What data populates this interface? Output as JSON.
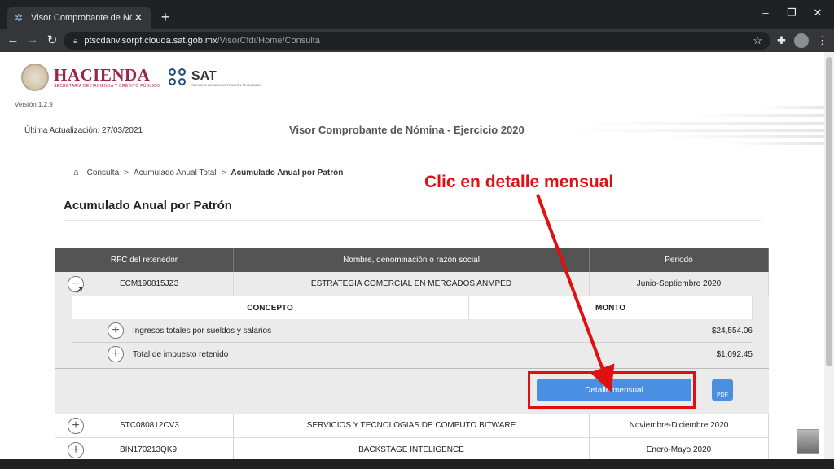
{
  "browser": {
    "tab_title": "Visor Comprobante de Nómina",
    "url_host": "ptscdanvisorpf.clouda.sat.gob.mx",
    "url_path": "/VisorCfdi/Home/Consulta",
    "window_controls": {
      "minimize": "–",
      "restore": "❐",
      "close": "✕"
    },
    "new_tab": "+",
    "tab_close": "✕"
  },
  "header": {
    "hacienda_name": "HACIENDA",
    "hacienda_sub": "SECRETARÍA DE HACIENDA Y CRÉDITO PÚBLICO",
    "sat_name": "SAT",
    "sat_sub": "SERVICIO DE ADMINISTRACIÓN TRIBUTARIA",
    "version": "Versión 1.2.9",
    "last_update": "Última Actualización: 27/03/2021",
    "title": "Visor Comprobante de Nómina - Ejercicio 2020"
  },
  "breadcrumb": {
    "items": [
      "Consulta",
      "Acumulado Anual Total",
      "Acumulado Anual por Patrón"
    ],
    "separator": ">"
  },
  "section_title": "Acumulado Anual por Patrón",
  "table": {
    "columns": [
      "RFC del retenedor",
      "Nombre, denominación o razón social",
      "Periodo"
    ],
    "rows": [
      {
        "rfc": "ECM190815JZ3",
        "name": "ESTRATEGIA COMERCIAL EN MERCADOS ANMPED",
        "period": "Junio-Septiembre 2020"
      },
      {
        "rfc": "STC080812CV3",
        "name": "SERVICIOS Y TECNOLOGIAS DE COMPUTO BITWARE",
        "period": "Noviembre-Diciembre 2020"
      },
      {
        "rfc": "BIN170213QK9",
        "name": "BACKSTAGE INTELIGENCE",
        "period": "Enero-Mayo 2020"
      }
    ],
    "detail": {
      "columns": [
        "CONCEPTO",
        "MONTO"
      ],
      "items": [
        {
          "concept": "Ingresos totales por sueldos y salarios",
          "amount": "$24,554.06"
        },
        {
          "concept": "Total de impuesto retenido",
          "amount": "$1,092.45"
        }
      ],
      "button": "Detalle mensual",
      "pdf_label": "PDF"
    },
    "expand_symbol": "+",
    "collapse_symbol": "−"
  },
  "annotation": "Clic en detalle mensual",
  "colors": {
    "accent": "#4a90e2",
    "annotation": "#e01010",
    "header_bg": "#545454",
    "hacienda": "#9d2449"
  }
}
